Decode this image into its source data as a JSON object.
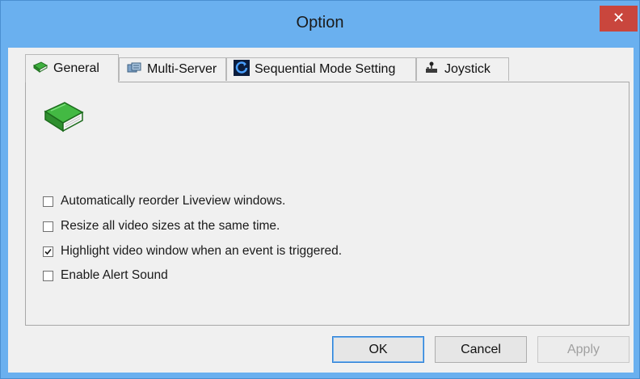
{
  "window": {
    "title": "Option",
    "close_glyph": "✕"
  },
  "tabs": [
    {
      "label": "General",
      "icon": "green-book-icon",
      "active": true
    },
    {
      "label": "Multi-Server",
      "icon": "servers-icon",
      "active": false
    },
    {
      "label": "Sequential Mode Setting",
      "icon": "cycle-icon",
      "active": false
    },
    {
      "label": "Joystick",
      "icon": "joystick-icon",
      "active": false
    }
  ],
  "general": {
    "icon": "green-book-icon",
    "options": [
      {
        "label": "Automatically reorder Liveview windows.",
        "checked": false
      },
      {
        "label": "Resize all video sizes at the same time.",
        "checked": false
      },
      {
        "label": "Highlight video window when an event is triggered.",
        "checked": true
      },
      {
        "label": "Enable Alert Sound",
        "checked": false
      }
    ]
  },
  "buttons": {
    "ok": "OK",
    "cancel": "Cancel",
    "apply": "Apply"
  },
  "colors": {
    "titlebar": "#6ab0ef",
    "close": "#c9463d",
    "dialog_bg": "#f0f0f0",
    "book_green": "#3aa83a"
  }
}
